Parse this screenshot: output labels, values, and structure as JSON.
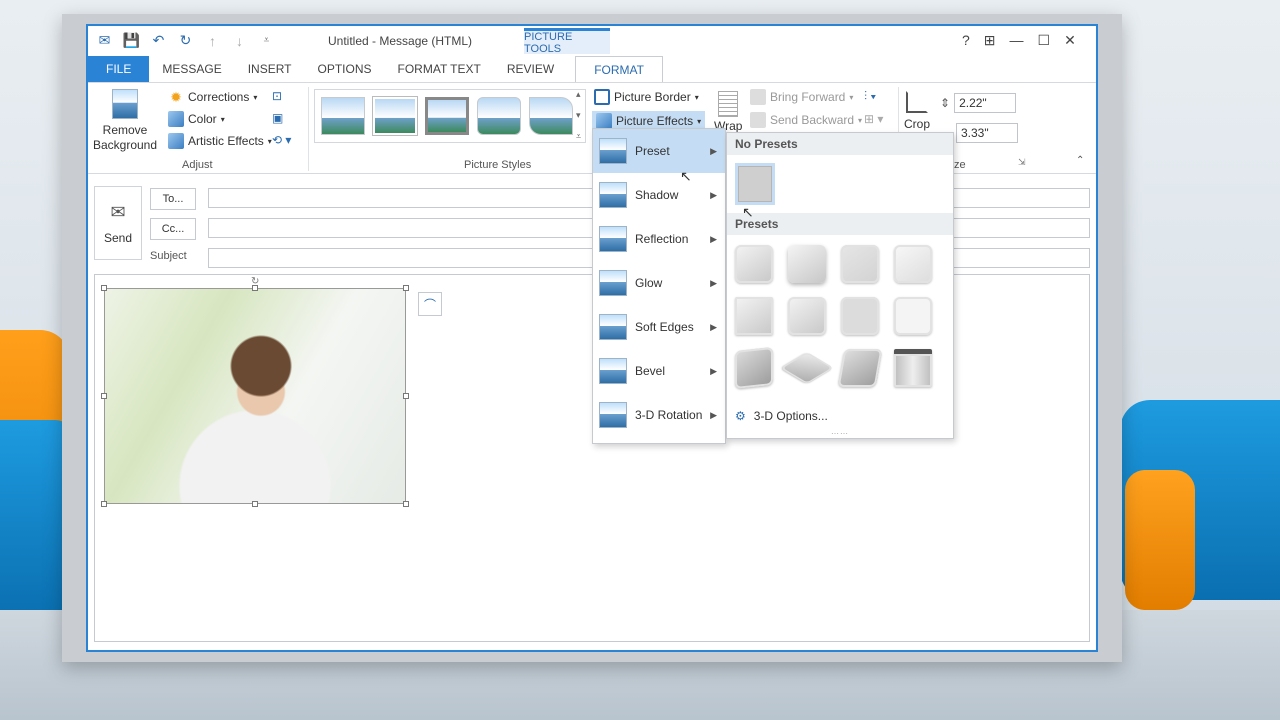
{
  "window": {
    "title": "Untitled - Message (HTML)",
    "contextual_tab_group": "PICTURE TOOLS",
    "controls": [
      "?",
      "⊞",
      "—",
      "☐",
      "✕"
    ]
  },
  "tabs": [
    "FILE",
    "MESSAGE",
    "INSERT",
    "OPTIONS",
    "FORMAT TEXT",
    "REVIEW",
    "FORMAT"
  ],
  "ribbon": {
    "adjust": {
      "remove_background": "Remove Background",
      "corrections": "Corrections",
      "color": "Color",
      "artistic_effects": "Artistic Effects",
      "label": "Adjust"
    },
    "picture_styles": {
      "label": "Picture Styles"
    },
    "picture_border": "Picture Border",
    "picture_effects": "Picture Effects",
    "wrap": "Wrap",
    "bring_forward": "Bring Forward",
    "send_backward": "Send Backward",
    "crop": "Crop",
    "height": "2.22\"",
    "width": "3.33\"",
    "size_label": "ze"
  },
  "compose": {
    "send": "Send",
    "to": "To...",
    "cc": "Cc...",
    "subject": "Subject"
  },
  "effects_menu": [
    {
      "label": "Preset"
    },
    {
      "label": "Shadow"
    },
    {
      "label": "Reflection"
    },
    {
      "label": "Glow"
    },
    {
      "label": "Soft Edges"
    },
    {
      "label": "Bevel"
    },
    {
      "label": "3-D Rotation"
    }
  ],
  "preset_submenu": {
    "no_presets": "No Presets",
    "presets": "Presets",
    "options": "3-D Options..."
  }
}
